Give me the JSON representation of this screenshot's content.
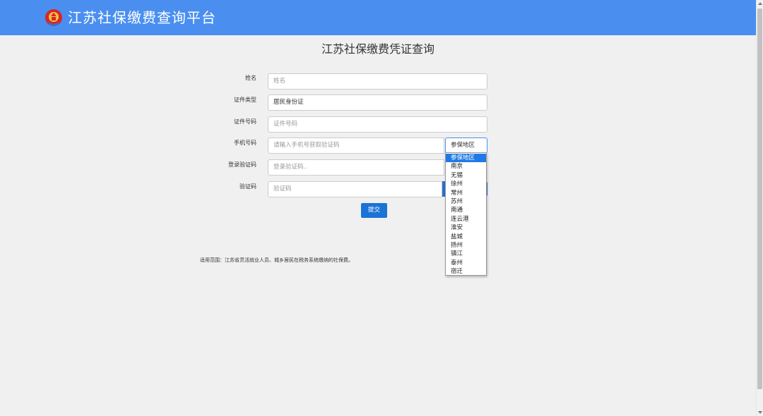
{
  "header": {
    "emblem_icon": "tax-emblem-icon",
    "title": "江苏社保缴费查询平台",
    "bg_color": "#4a8ff0"
  },
  "page": {
    "title": "江苏社保缴费凭证查询"
  },
  "form": {
    "name": {
      "label": "姓名",
      "placeholder": "姓名"
    },
    "id_type": {
      "label": "证件类型",
      "value": "居民身份证"
    },
    "id_number": {
      "label": "证件号码",
      "placeholder": "证件号码"
    },
    "phone": {
      "label": "手机号码",
      "placeholder": "请输入手机号获取验证码"
    },
    "region": {
      "selected": "参保地区"
    },
    "login_code": {
      "label": "登录验证码",
      "placeholder": "登录验证码.."
    },
    "captcha": {
      "label": "验证码",
      "placeholder": "验证码"
    },
    "submit_label": "提交"
  },
  "region_dropdown": {
    "options": [
      "参保地区",
      "南京",
      "无锡",
      "徐州",
      "常州",
      "苏州",
      "南通",
      "连云港",
      "淮安",
      "盐城",
      "扬州",
      "镇江",
      "泰州",
      "宿迁"
    ],
    "selected_index": 0
  },
  "note": "适用范围：江苏省灵活就业人员、城乡居民在税务系统缴纳的社保费。"
}
